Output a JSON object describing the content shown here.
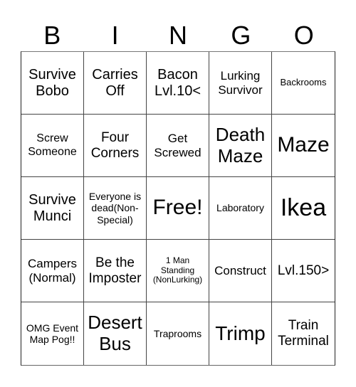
{
  "header": {
    "letters": [
      "B",
      "I",
      "N",
      "G",
      "O"
    ]
  },
  "cells": [
    "Survive Bobo",
    "Carries Off",
    "Bacon Lvl.10<",
    "Lurking Survivor",
    "Backrooms",
    "Screw Someone",
    "Four Corners",
    "Get Screwed",
    "Death Maze",
    "Maze",
    "Survive Munci",
    "Everyone is dead(Non-Special)",
    "Free!",
    "Laboratory",
    "Ikea",
    "Campers (Normal)",
    "Be the Imposter",
    "1 Man Standing (NonLurking)",
    "Construct",
    "Lvl.150>",
    "OMG Event Map Pog!!",
    "Desert Bus",
    "Traprooms",
    "Trimp",
    "Train Terminal"
  ]
}
